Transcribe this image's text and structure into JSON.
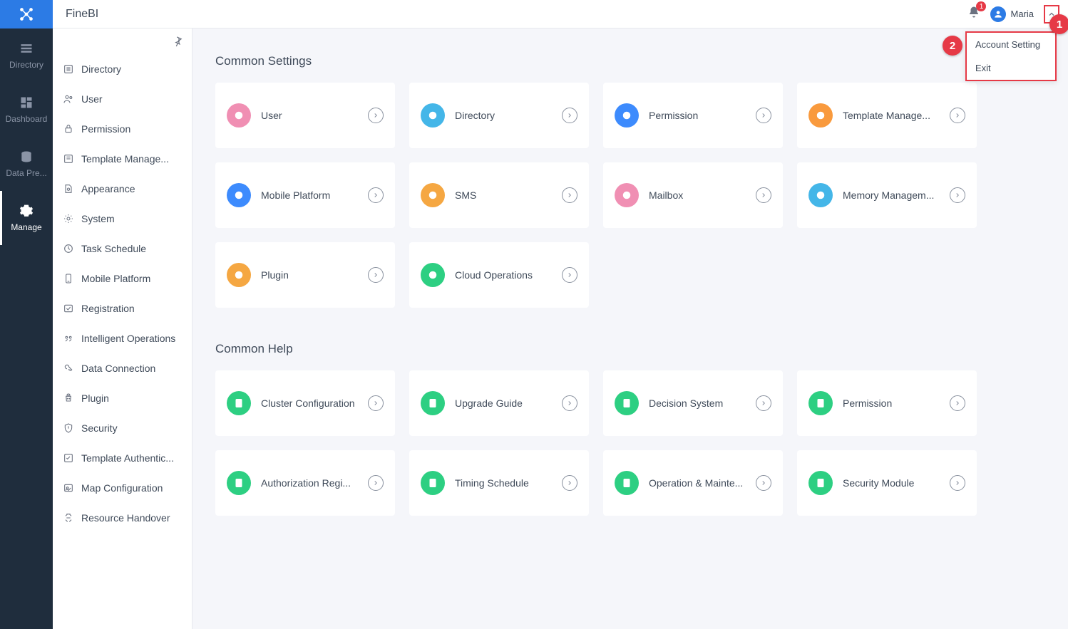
{
  "header": {
    "app_title": "FineBI",
    "notification_count": "1",
    "username": "Maria"
  },
  "dropdown": {
    "account_setting": "Account Setting",
    "exit": "Exit"
  },
  "annotations": {
    "a1": "1",
    "a2": "2"
  },
  "nav_rail": [
    {
      "label": "Directory"
    },
    {
      "label": "Dashboard"
    },
    {
      "label": "Data Pre..."
    },
    {
      "label": "Manage"
    }
  ],
  "sidebar": [
    {
      "label": "Directory"
    },
    {
      "label": "User"
    },
    {
      "label": "Permission"
    },
    {
      "label": "Template Manage..."
    },
    {
      "label": "Appearance"
    },
    {
      "label": "System"
    },
    {
      "label": "Task Schedule"
    },
    {
      "label": "Mobile Platform"
    },
    {
      "label": "Registration"
    },
    {
      "label": "Intelligent Operations"
    },
    {
      "label": "Data Connection"
    },
    {
      "label": "Plugin"
    },
    {
      "label": "Security"
    },
    {
      "label": "Template Authentic..."
    },
    {
      "label": "Map Configuration"
    },
    {
      "label": "Resource Handover"
    }
  ],
  "sections": {
    "settings_title": "Common Settings",
    "help_title": "Common Help"
  },
  "settings_cards": [
    {
      "label": "User",
      "color": "#f08fb3"
    },
    {
      "label": "Directory",
      "color": "#44b6e8"
    },
    {
      "label": "Permission",
      "color": "#3d8bfd"
    },
    {
      "label": "Template Manage...",
      "color": "#f99a3d"
    },
    {
      "label": "Mobile Platform",
      "color": "#3d8bfd"
    },
    {
      "label": "SMS",
      "color": "#f5a742"
    },
    {
      "label": "Mailbox",
      "color": "#f08fb3"
    },
    {
      "label": "Memory Managem...",
      "color": "#44b6e8"
    },
    {
      "label": "Plugin",
      "color": "#f5a742"
    },
    {
      "label": "Cloud Operations",
      "color": "#2dcf82"
    }
  ],
  "help_cards": [
    {
      "label": "Cluster Configuration",
      "color": "#2dcf82"
    },
    {
      "label": "Upgrade Guide",
      "color": "#2dcf82"
    },
    {
      "label": "Decision System",
      "color": "#2dcf82"
    },
    {
      "label": "Permission",
      "color": "#2dcf82"
    },
    {
      "label": "Authorization Regi...",
      "color": "#2dcf82"
    },
    {
      "label": "Timing Schedule",
      "color": "#2dcf82"
    },
    {
      "label": "Operation & Mainte...",
      "color": "#2dcf82"
    },
    {
      "label": "Security Module",
      "color": "#2dcf82"
    }
  ]
}
